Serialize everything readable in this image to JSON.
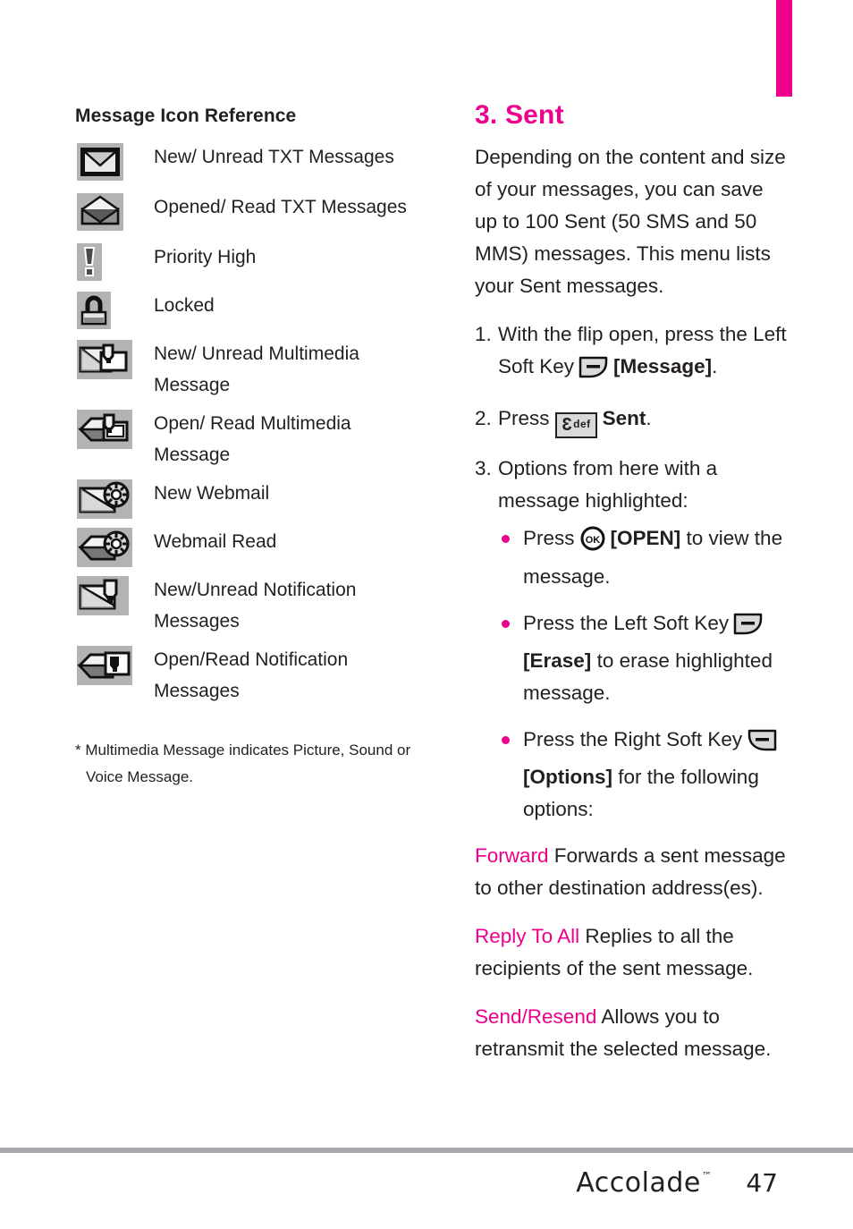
{
  "page": {
    "number": "47",
    "brand": "Accolade",
    "brand_tm": "™",
    "accent_color": "#ec008c",
    "rule_color": "#a7a9ac"
  },
  "left_column": {
    "title": "Message Icon Reference",
    "items": [
      {
        "icon": "envelope-closed-icon",
        "label": "New/ Unread TXT Messages"
      },
      {
        "icon": "envelope-open-icon",
        "label": "Opened/ Read TXT Messages"
      },
      {
        "icon": "priority-high-icon",
        "label": "Priority High"
      },
      {
        "icon": "padlock-icon",
        "label": "Locked"
      },
      {
        "icon": "multimedia-unread-icon",
        "label": "New/ Unread Multimedia Message"
      },
      {
        "icon": "multimedia-read-icon",
        "label": "Open/ Read Multimedia Message"
      },
      {
        "icon": "webmail-new-icon",
        "label": "New Webmail"
      },
      {
        "icon": "webmail-read-icon",
        "label": "Webmail Read"
      },
      {
        "icon": "notification-unread-icon",
        "label": "New/Unread Notification Messages"
      },
      {
        "icon": "notification-read-icon",
        "label": "Open/Read Notification Messages"
      }
    ],
    "footnote": "* Multimedia Message indicates Picture, Sound or Voice Message."
  },
  "right_column": {
    "section_title": "3. Sent",
    "intro": "Depending on the content and size of your messages, you can save up to 100 Sent (50 SMS and 50 MMS) messages. This menu lists your Sent messages.",
    "steps": [
      {
        "num": "1.",
        "text_before": "With the flip open, press the Left Soft Key",
        "key": "left-soft-key-icon",
        "bold_text": "[Message]",
        "text_after": "."
      },
      {
        "num": "2.",
        "text_before": "Press",
        "key": "key-3-def",
        "key_digit": "3",
        "key_letters": "def",
        "bold_text": "Sent",
        "text_after": "."
      },
      {
        "num": "3.",
        "text_before": "Options from here with a message highlighted:",
        "key": "",
        "bold_text": "",
        "text_after": ""
      }
    ],
    "bullets": [
      {
        "text_before": "Press",
        "key": "ok-key-icon",
        "bold_text": "[OPEN]",
        "text_after": "to view the message."
      },
      {
        "text_before": "Press the Left Soft Key",
        "key": "left-soft-key-icon",
        "bold_text": "[Erase]",
        "text_after": "to erase highlighted message."
      },
      {
        "text_before": "Press the Right Soft Key",
        "key": "right-soft-key-icon",
        "bold_text": "[Options]",
        "text_after": "for the following options:"
      }
    ],
    "options": [
      {
        "name": "Forward",
        "description": "Forwards a sent message to other destination address(es)."
      },
      {
        "name": "Reply To All",
        "description": "Replies to all the recipients of the sent message."
      },
      {
        "name": "Send/Resend",
        "description": "Allows you to retransmit the selected message."
      }
    ]
  }
}
